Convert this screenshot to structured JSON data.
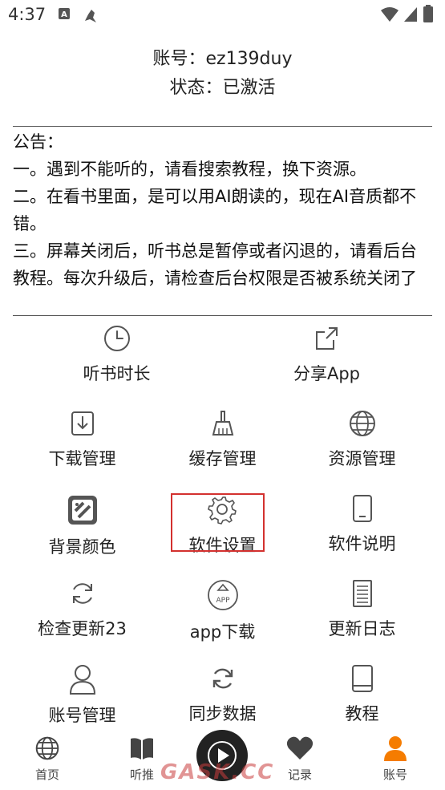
{
  "status_bar": {
    "time": "4:37",
    "icons": [
      "a-badge-icon",
      "bird-icon",
      "wifi-icon",
      "signal-icon",
      "battery-icon"
    ]
  },
  "account": {
    "account_line": "账号：ez139duy",
    "status_line": "状态：已激活"
  },
  "notice": {
    "title": "公告：",
    "lines": [
      "一。遇到不能听的，请看搜索教程，换下资源。",
      "二。在看书里面，是可以用AI朗读的，现在AI音质都不错。",
      "三。屏幕关闭后，听书总是暂停或者闪退的，请看后台教程。每次升级后，请检查后台权限是否被系统关闭了"
    ]
  },
  "menu": {
    "row1": [
      {
        "label": "听书时长",
        "icon": "clock-icon"
      },
      {
        "label": "分享App",
        "icon": "share-icon"
      }
    ],
    "row2": [
      {
        "label": "下载管理",
        "icon": "download-icon"
      },
      {
        "label": "缓存管理",
        "icon": "broom-icon"
      },
      {
        "label": "资源管理",
        "icon": "globe-icon"
      }
    ],
    "row3": [
      {
        "label": "背景颜色",
        "icon": "palette-icon"
      },
      {
        "label": "软件设置",
        "icon": "gear-icon"
      },
      {
        "label": "软件说明",
        "icon": "phone-icon"
      }
    ],
    "row4": [
      {
        "label": "检查更新23",
        "icon": "refresh-icon"
      },
      {
        "label": "app下载",
        "icon": "app-upload-icon"
      },
      {
        "label": "更新日志",
        "icon": "document-icon"
      }
    ],
    "row5": [
      {
        "label": "账号管理",
        "icon": "user-icon"
      },
      {
        "label": "同步数据",
        "icon": "sync-icon"
      },
      {
        "label": "教程",
        "icon": "tablet-icon"
      }
    ]
  },
  "bottom_nav": {
    "items": [
      {
        "label": "首页",
        "icon": "globe-icon"
      },
      {
        "label": "听推",
        "icon": "book-icon"
      },
      {
        "label": "记录",
        "icon": "heart-icon"
      },
      {
        "label": "账号",
        "icon": "user-icon"
      }
    ],
    "active_color": "#f57c00"
  },
  "watermark": "GASK.CC",
  "colors": {
    "highlight_border": "#d3312f",
    "icon": "#555555",
    "accent": "#f57c00"
  }
}
